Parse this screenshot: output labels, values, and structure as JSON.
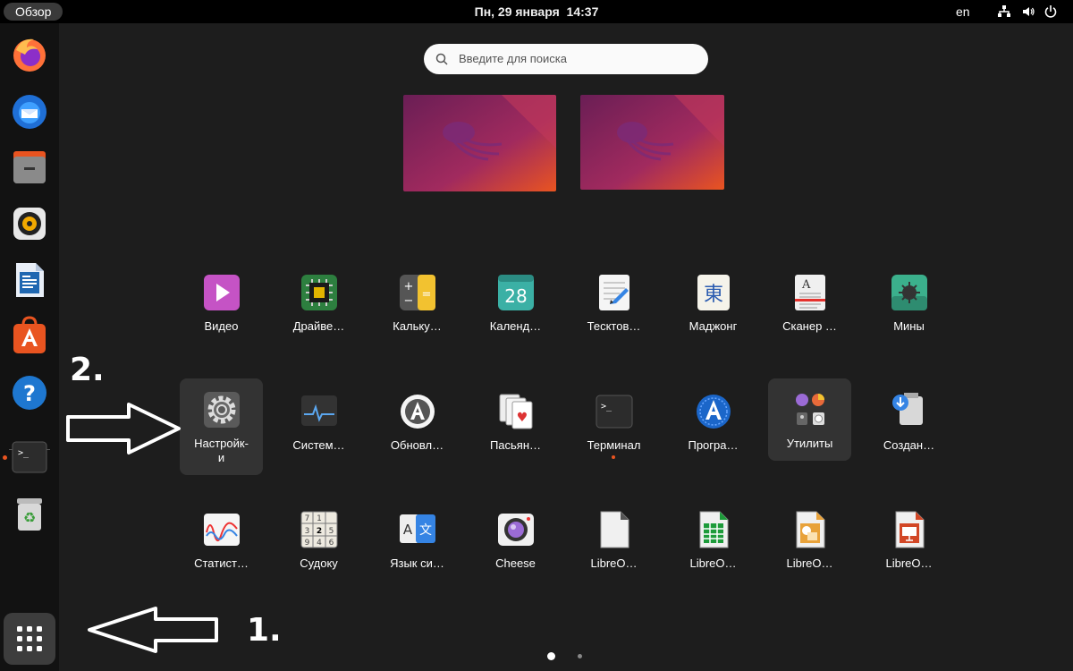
{
  "topbar": {
    "activities": "Обзор",
    "date": "Пн, 29 января",
    "time": "14:37",
    "language": "en",
    "tray_icons": [
      "network-icon",
      "volume-icon",
      "power-icon"
    ]
  },
  "dock": {
    "items": [
      {
        "name": "firefox-icon"
      },
      {
        "name": "thunderbird-icon"
      },
      {
        "name": "files-icon"
      },
      {
        "name": "rhythmbox-icon"
      },
      {
        "name": "libreoffice-writer-icon"
      },
      {
        "name": "app-center-icon"
      },
      {
        "name": "help-icon"
      },
      {
        "name": "terminal-icon",
        "running": true
      },
      {
        "name": "trash-icon"
      }
    ],
    "show_apps": "show-apps-icon"
  },
  "search": {
    "placeholder": "Введите для поиска"
  },
  "apps": [
    {
      "label": "Видео",
      "icon": "video-icon"
    },
    {
      "label": "Драйве…",
      "icon": "drivers-icon"
    },
    {
      "label": "Кальку…",
      "icon": "calculator-icon"
    },
    {
      "label": "Календ…",
      "icon": "calendar-icon",
      "icon_text": "28"
    },
    {
      "label": "Тесктов…",
      "icon": "text-editor-icon"
    },
    {
      "label": "Маджонг",
      "icon": "mahjong-icon",
      "icon_text": "東"
    },
    {
      "label": "Сканер …",
      "icon": "scanner-icon"
    },
    {
      "label": "Мины",
      "icon": "mines-icon"
    },
    {
      "label": "Настройк-и",
      "label_line1": "Настройк-",
      "label_line2": "и",
      "icon": "settings-icon",
      "highlighted": true
    },
    {
      "label": "Систем…",
      "icon": "system-monitor-icon"
    },
    {
      "label": "Обновл…",
      "icon": "updater-icon"
    },
    {
      "label": "Пасьян…",
      "icon": "solitaire-icon"
    },
    {
      "label": "Терминал",
      "icon": "terminal-icon",
      "running": true
    },
    {
      "label": "Програ…",
      "icon": "software-icon"
    },
    {
      "label": "Утилиты",
      "icon": "utilities-folder-icon",
      "highlighted": true
    },
    {
      "label": "Создан…",
      "icon": "startup-disk-icon"
    },
    {
      "label": "Статист…",
      "icon": "power-statistics-icon"
    },
    {
      "label": "Судоку",
      "icon": "sudoku-icon"
    },
    {
      "label": "Язык си…",
      "icon": "language-support-icon",
      "icon_text": "A 文"
    },
    {
      "label": "Cheese",
      "icon": "cheese-icon"
    },
    {
      "label": "LibreO…",
      "icon": "libreoffice-icon"
    },
    {
      "label": "LibreO…",
      "icon": "libreoffice-calc-icon"
    },
    {
      "label": "LibreO…",
      "icon": "libreoffice-draw-icon"
    },
    {
      "label": "LibreO…",
      "icon": "libreoffice-impress-icon"
    }
  ],
  "pagination": {
    "pages": 2,
    "current": 1
  },
  "annotations": {
    "step1": "1.",
    "step2": "2."
  },
  "colors": {
    "accent": "#e95420",
    "background": "#1d1d1d"
  }
}
